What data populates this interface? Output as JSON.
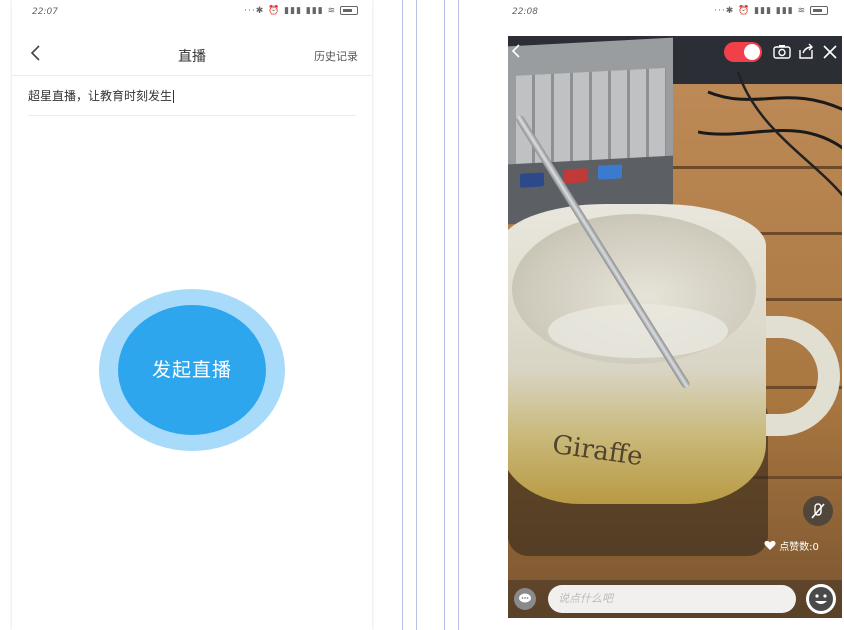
{
  "left_screen": {
    "status_time": "22:07",
    "nav": {
      "title": "直播",
      "history_label": "历史记录"
    },
    "title_input_value": "超星直播，让教育时刻发生",
    "start_button_label": "发起直播"
  },
  "right_screen": {
    "status_time": "22:08",
    "likes_label": "点赞数:0",
    "comment_placeholder": "说点什么吧",
    "mug_brand_text": "Giraffe"
  },
  "colors": {
    "primary_blue": "#2ea6ee",
    "halo_blue": "#a8dbfa",
    "live_red": "#f2404b"
  }
}
